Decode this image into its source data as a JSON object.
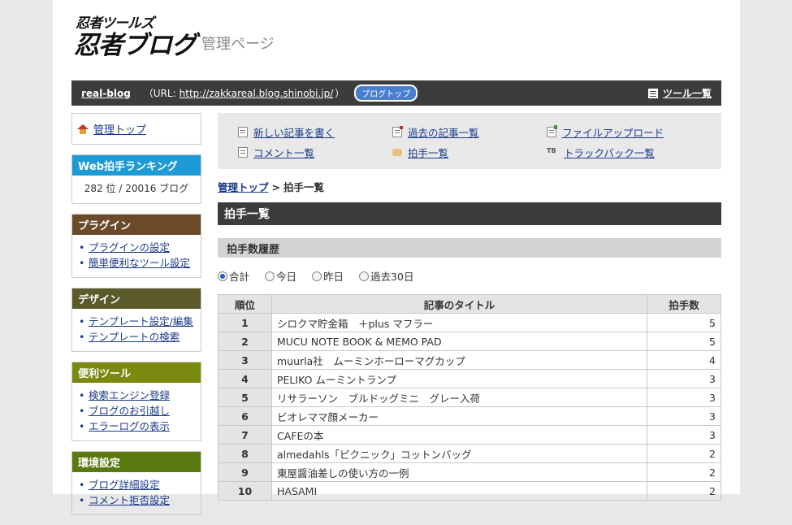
{
  "header": {
    "logo_small": "忍者ツールズ",
    "logo_big": "忍者ブログ",
    "admin_title": "管理ページ"
  },
  "topbar": {
    "blog_name": "real-blog",
    "url_label": "（URL:",
    "url": "http://zakkareal.blog.shinobi.jp/",
    "url_tail": "）",
    "blogtop_button": "ブログトップ",
    "tool_list": "ツール一覧"
  },
  "sidebar": {
    "home": "管理トップ",
    "ranking": {
      "title": "Web拍手ランキング",
      "value": "282 位 / 20016 ブログ"
    },
    "sections": [
      {
        "title": "プラグイン",
        "color": "#6b4a2a",
        "items": [
          "プラグインの設定",
          "簡単便利なツール設定"
        ]
      },
      {
        "title": "デザイン",
        "color": "#5a5a2a",
        "items": [
          "テンプレート設定/編集",
          "テンプレートの検索"
        ]
      },
      {
        "title": "便利ツール",
        "color": "#7a8a10",
        "items": [
          "検索エンジン登録",
          "ブログのお引越し",
          "エラーログの表示"
        ]
      },
      {
        "title": "環境設定",
        "color": "#5a7a10",
        "items": [
          "ブログ詳細設定",
          "コメント拒否設定"
        ]
      }
    ]
  },
  "quicklinks": {
    "new_post": "新しい記事を書く",
    "past_posts": "過去の記事一覧",
    "file_upload": "ファイルアップロード",
    "comments": "コメント一覧",
    "clap_list": "拍手一覧",
    "trackbacks": "トラックバック一覧"
  },
  "breadcrumb": {
    "home": "管理トップ",
    "sep": ">",
    "current": "拍手一覧"
  },
  "page_title": "拍手一覧",
  "section_title": "拍手数履歴",
  "period_options": [
    "合計",
    "今日",
    "昨日",
    "過去30日"
  ],
  "period_selected": "合計",
  "table": {
    "headers": [
      "順位",
      "記事のタイトル",
      "拍手数"
    ],
    "rows": [
      {
        "rank": "1",
        "title": "シロクマ貯金箱　＋plus マフラー",
        "count": "5"
      },
      {
        "rank": "2",
        "title": "MUCU NOTE BOOK & MEMO PAD",
        "count": "5"
      },
      {
        "rank": "3",
        "title": "muurla社　ムーミンホーローマグカップ",
        "count": "4"
      },
      {
        "rank": "4",
        "title": "PELIKO ムーミントランプ",
        "count": "3"
      },
      {
        "rank": "5",
        "title": "リサラーソン　ブルドッグミニ　グレー入荷",
        "count": "3"
      },
      {
        "rank": "6",
        "title": "ビオレママ顔メーカー",
        "count": "3"
      },
      {
        "rank": "7",
        "title": "CAFEの本",
        "count": "3"
      },
      {
        "rank": "8",
        "title": "almedahls「ピクニック」コットンバッグ",
        "count": "2"
      },
      {
        "rank": "9",
        "title": "東屋醤油差しの使い方の一例",
        "count": "2"
      },
      {
        "rank": "10",
        "title": "HASAMI",
        "count": "2"
      }
    ]
  }
}
